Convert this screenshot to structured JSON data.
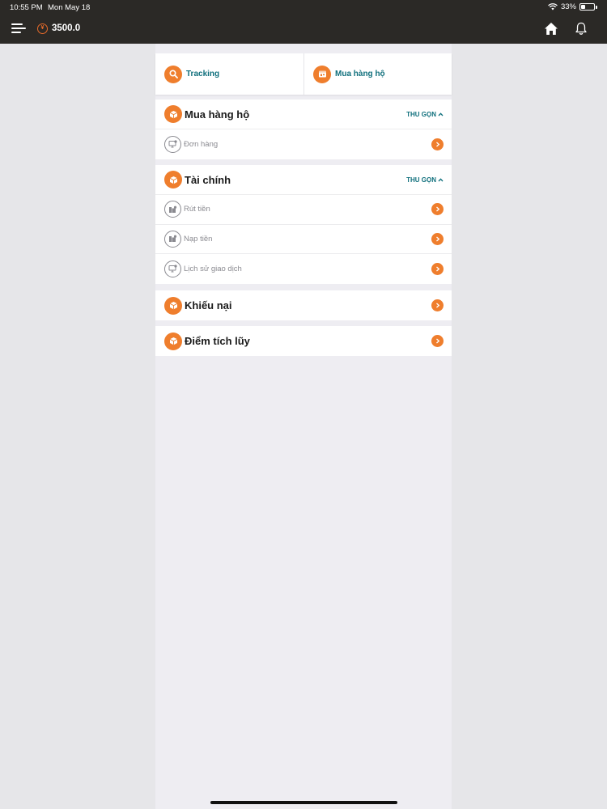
{
  "status_bar": {
    "time": "10:55 PM",
    "date": "Mon May 18",
    "battery": "33%"
  },
  "header": {
    "currency_symbol": "¥",
    "balance": "3500.0"
  },
  "quick_actions": [
    {
      "label": "Tracking",
      "icon": "search-icon"
    },
    {
      "label": "Mua hàng hộ",
      "icon": "store-icon"
    }
  ],
  "sections": {
    "purchase": {
      "title": "Mua hàng hộ",
      "collapse": "THU GỌN",
      "items": [
        {
          "label": "Đơn hàng"
        }
      ]
    },
    "finance": {
      "title": "Tài chính",
      "collapse": "THU GỌN",
      "items": [
        {
          "label": "Rút tiền"
        },
        {
          "label": "Nạp tiền"
        },
        {
          "label": "Lịch sử giao dịch"
        }
      ]
    },
    "complaint": {
      "title": "Khiếu nại"
    },
    "points": {
      "title": "Điểm tích lũy"
    }
  },
  "colors": {
    "accent": "#ef7e2d",
    "teal": "#0f6f7c",
    "header_bg": "#2b2926"
  }
}
